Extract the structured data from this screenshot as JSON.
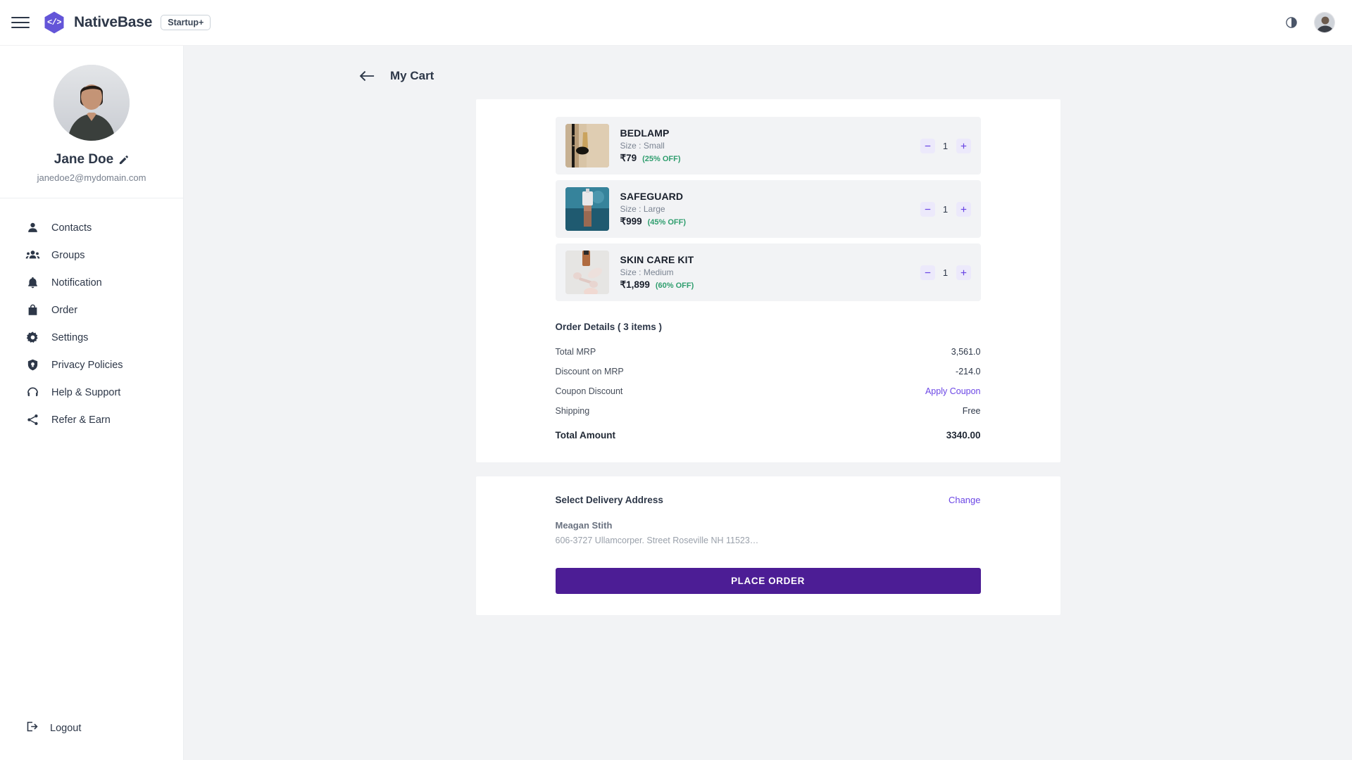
{
  "topbar": {
    "menu_icon": "hamburger-menu-icon",
    "logo_icon": "nativebase-hex-logo",
    "logo_glyph": "</>",
    "brand": "NativeBase",
    "badge": "Startup+",
    "theme_icon": "dark-mode-toggle-icon",
    "avatar_icon": "user-avatar"
  },
  "sidebar": {
    "profile": {
      "name": "Jane Doe",
      "email": "janedoe2@mydomain.com",
      "edit_icon": "pencil-edit-icon",
      "avatar_icon": "profile-photo"
    },
    "items": [
      {
        "label": "Contacts",
        "icon": "person-icon"
      },
      {
        "label": "Groups",
        "icon": "people-group-icon"
      },
      {
        "label": "Notification",
        "icon": "bell-icon"
      },
      {
        "label": "Order",
        "icon": "shopping-bag-icon"
      },
      {
        "label": "Settings",
        "icon": "gear-icon"
      },
      {
        "label": "Privacy Policies",
        "icon": "shield-icon"
      },
      {
        "label": "Help & Support",
        "icon": "headset-icon"
      },
      {
        "label": "Refer & Earn",
        "icon": "share-icon"
      }
    ],
    "logout": {
      "label": "Logout",
      "icon": "logout-icon"
    }
  },
  "main": {
    "back_icon": "back-arrow-icon",
    "title": "My Cart",
    "items": [
      {
        "name": "BEDLAMP",
        "size": "Size : Small",
        "price": "₹79",
        "discount": "(25% OFF)",
        "qty": "1",
        "thumb": "bedlamp-product-image"
      },
      {
        "name": "SAFEGUARD",
        "size": "Size : Large",
        "price": "₹999",
        "discount": "(45% OFF)",
        "qty": "1",
        "thumb": "safeguard-product-image"
      },
      {
        "name": "SKIN CARE KIT",
        "size": "Size : Medium",
        "price": "₹1,899",
        "discount": "(60% OFF)",
        "qty": "1",
        "thumb": "skin-care-kit-product-image"
      }
    ],
    "qty_minus_label": "−",
    "qty_plus_label": "+",
    "order_details": {
      "title": "Order Details ( 3 items )",
      "rows": [
        {
          "label": "Total MRP",
          "value": "3,561.0",
          "link": false
        },
        {
          "label": "Discount on MRP",
          "value": "-214.0",
          "link": false
        },
        {
          "label": "Coupon Discount",
          "value": "Apply Coupon",
          "link": true
        },
        {
          "label": "Shipping",
          "value": "Free",
          "link": false
        }
      ],
      "total_label": "Total Amount",
      "total_value": "3340.00"
    },
    "address": {
      "title": "Select Delivery Address",
      "change": "Change",
      "name": "Meagan Stith",
      "line": "606-3727 Ullamcorper. Street Roseville NH 11523…"
    },
    "place_order": "PLACE ORDER"
  },
  "colors": {
    "accent": "#6b46e5",
    "primary_button": "#4c1d95",
    "discount_green": "#2f9e6e",
    "text_dark": "#2d3748",
    "page_bg": "#f2f3f5"
  }
}
